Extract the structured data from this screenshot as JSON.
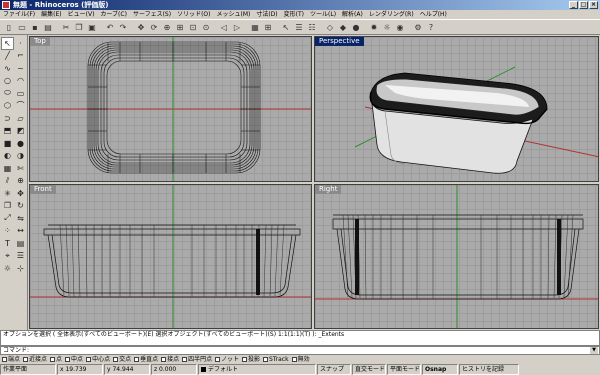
{
  "window": {
    "title": "無題 - Rhinoceros (評価版)"
  },
  "menu": [
    "ファイル(F)",
    "編集(E)",
    "ビュー(V)",
    "カーブ(C)",
    "サーフェス(S)",
    "ソリッド(O)",
    "メッシュ(M)",
    "寸法(D)",
    "変形(T)",
    "ツール(L)",
    "解析(A)",
    "レンダリング(R)",
    "ヘルプ(H)"
  ],
  "viewports": {
    "top": "Top",
    "perspective": "Perspective",
    "front": "Front",
    "right": "Right"
  },
  "command": {
    "history": "オプションを選択 ( 全体表示(すべてのビューポート)(E)  選択オブジェクト(すべてのビューポート)(S)  1:1(1:1)(T) ): _Extents",
    "prompt": "コマンド:"
  },
  "osnap": [
    "端点",
    "近接点",
    "点",
    "中点",
    "中心点",
    "交点",
    "垂直点",
    "接点",
    "四半円点",
    "ノット",
    "投影",
    "STrack",
    "無効"
  ],
  "status": {
    "cplane": "作業平面",
    "x": "x 19.739",
    "y": "y 74.944",
    "z": "z 0.000",
    "layer": "デフォルト",
    "snap": "スナップ",
    "ortho": "直交モード",
    "planar": "平面モード",
    "osnap": "Osnap",
    "history": "ヒストリを記録"
  },
  "colors": {
    "viewport_bg": "#aaaaaa",
    "grid": "#9d9d9d",
    "axis_x": "#b03030",
    "axis_y": "#2f8f2f",
    "active_label": "#0a246a"
  }
}
